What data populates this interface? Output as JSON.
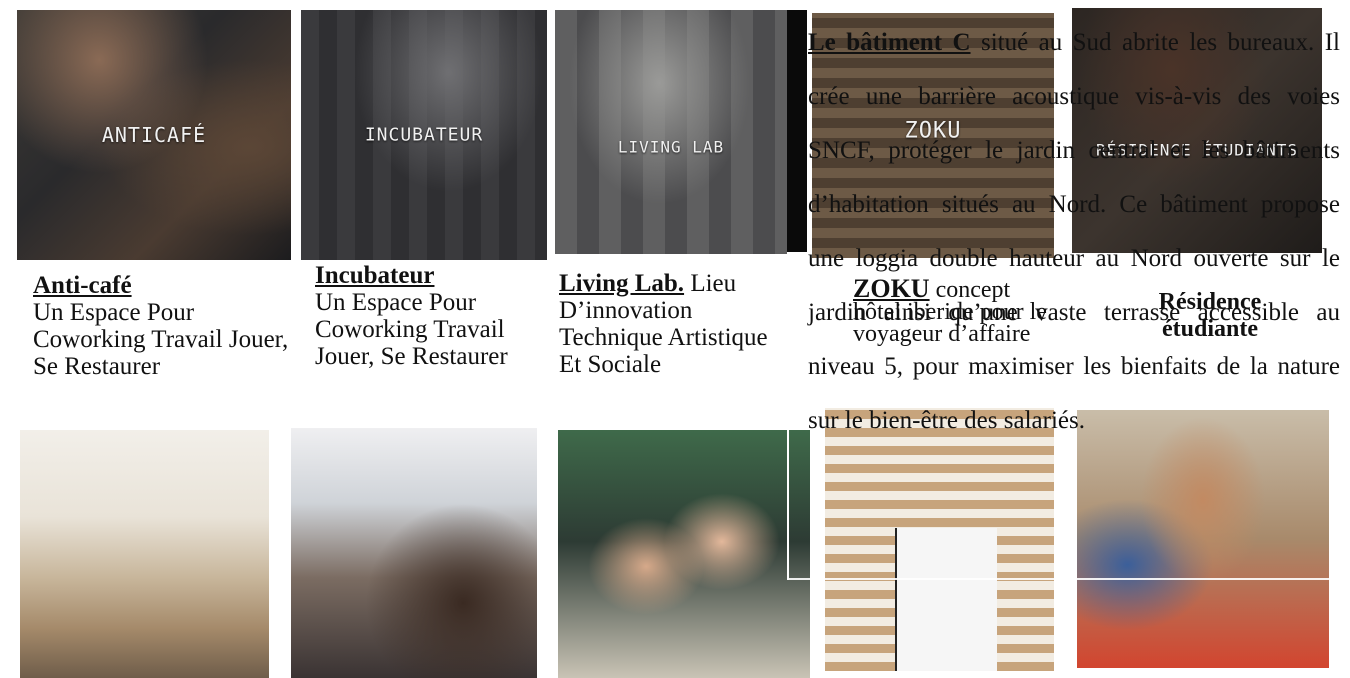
{
  "tiles": {
    "anticafe": "ANTICAFÉ",
    "incubateur": "INCUBATEUR",
    "livinglab": "LIVING LAB",
    "zoku": "ZOKU",
    "residence": "RÉSIDENCE ÉTUDIANTS"
  },
  "captions": {
    "anticafe": {
      "head": "Anti-café",
      "body": "Un Espace Pour Coworking Travail Jouer, Se Restaurer"
    },
    "incubateur": {
      "head": "Incubateur",
      "body": "Un Espace Pour Coworking Travail Jouer, Se Restaurer"
    },
    "livinglab": {
      "head": "Living Lab.",
      "body": " Lieu D’innovation Technique Artistique Et Sociale"
    },
    "zoku": {
      "head": "ZOKU",
      "body": " concept hôtel iberide pour le voyageur d’affaire"
    },
    "residence": {
      "head": "Résidence étudiante"
    }
  },
  "paragraph": {
    "lead": "Le bâtiment C",
    "text": " situé au Sud abrite les bureaux. Il crée une barrière acoustique vis-à-vis des voies SNCF, protéger le jardin central et les bâtiments d’habitation situés au Nord. Ce bâtiment propose une loggia double hauteur au Nord ouverte sur le jardin ainsi qu’une vaste terrasse accessible au niveau 5, pour maximiser les bienfaits de la nature sur le bien-être des salariés."
  }
}
